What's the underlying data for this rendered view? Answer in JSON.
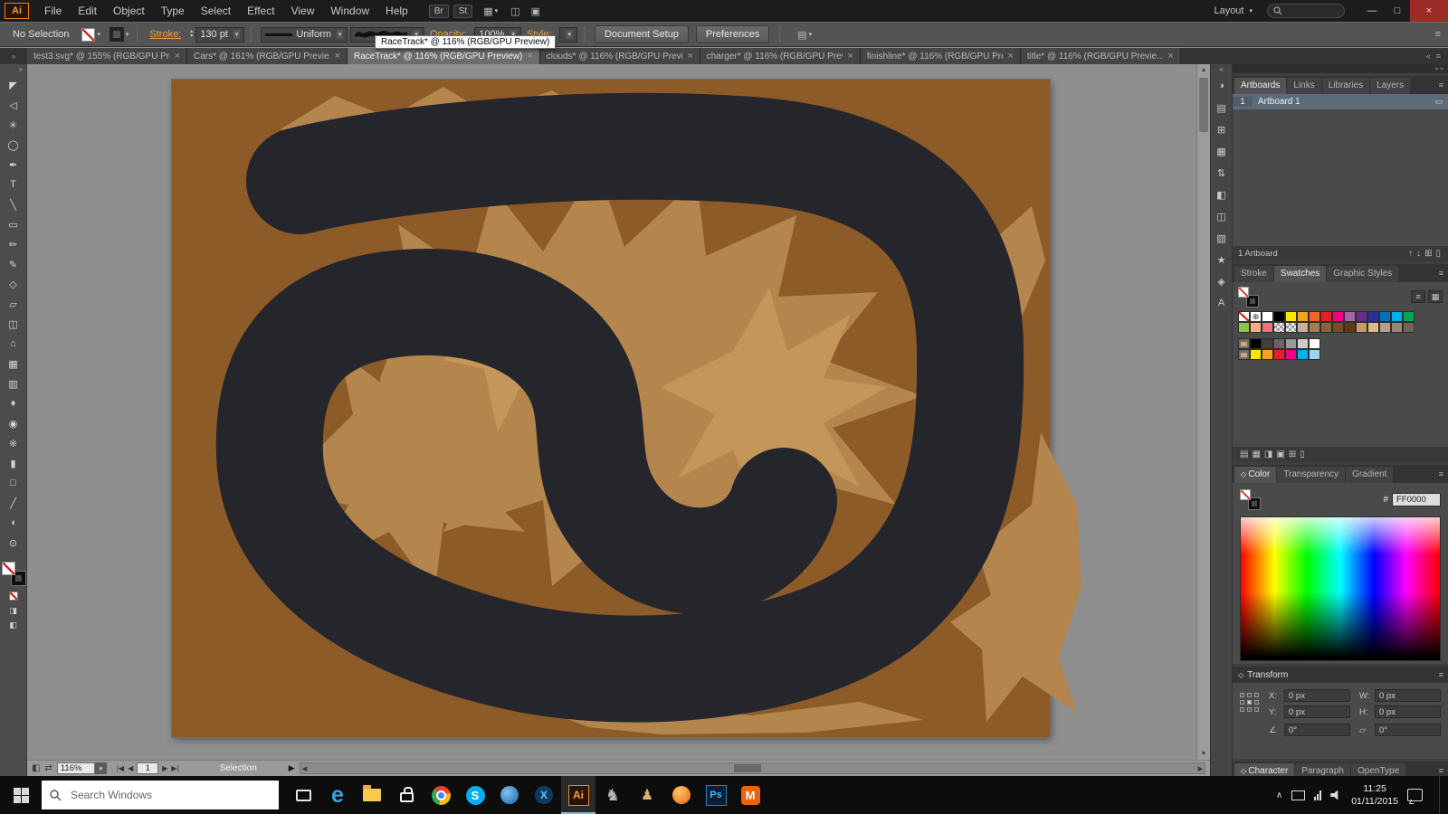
{
  "menubar": {
    "logo": "Ai",
    "menus": [
      "File",
      "Edit",
      "Object",
      "Type",
      "Select",
      "Effect",
      "View",
      "Window",
      "Help"
    ],
    "quick_buttons": [
      "Br",
      "St"
    ],
    "layout_label": "Layout",
    "win_controls": [
      "—",
      "□",
      "×"
    ]
  },
  "controlbar": {
    "selection_label": "No Selection",
    "stroke_label": "Stroke:",
    "stroke_width": "130 pt",
    "profile_label": "Uniform",
    "opacity_label": "Opacity:",
    "opacity_value": "100%",
    "style_label": "Style:",
    "document_setup": "Document Setup",
    "preferences": "Preferences",
    "tooltip": "RaceTrack* @ 116% (RGB/GPU Preview)"
  },
  "tabs": [
    {
      "label": "test3.svg* @ 155% (RGB/GPU Prev...",
      "active": false
    },
    {
      "label": "Cars* @ 161% (RGB/GPU Previe...",
      "active": false
    },
    {
      "label": "RaceTrack* @ 116% (RGB/GPU Preview)",
      "active": true
    },
    {
      "label": "clouds* @ 116% (RGB/GPU Previe...",
      "active": false
    },
    {
      "label": "charger* @ 116% (RGB/GPU Previ...",
      "active": false
    },
    {
      "label": "finishline* @ 116% (RGB/GPU Pre...",
      "active": false
    },
    {
      "label": "title* @ 116% (RGB/GPU Previe...",
      "active": false
    }
  ],
  "toolbox": {
    "tools": [
      {
        "name": "selection-tool",
        "glyph": "◤"
      },
      {
        "name": "direct-selection-tool",
        "glyph": "◁"
      },
      {
        "name": "magic-wand-tool",
        "glyph": "✳"
      },
      {
        "name": "lasso-tool",
        "glyph": "◯"
      },
      {
        "name": "pen-tool",
        "glyph": "✒"
      },
      {
        "name": "type-tool",
        "glyph": "T"
      },
      {
        "name": "line-segment-tool",
        "glyph": "╲"
      },
      {
        "name": "rectangle-tool",
        "glyph": "▭"
      },
      {
        "name": "paintbrush-tool",
        "glyph": "✏"
      },
      {
        "name": "pencil-tool",
        "glyph": "✎"
      },
      {
        "name": "width-tool",
        "glyph": "◇"
      },
      {
        "name": "free-transform-tool",
        "glyph": "▱"
      },
      {
        "name": "shape-builder-tool",
        "glyph": "◫"
      },
      {
        "name": "perspective-grid-tool",
        "glyph": "⌂"
      },
      {
        "name": "mesh-tool",
        "glyph": "▦"
      },
      {
        "name": "gradient-tool",
        "glyph": "▥"
      },
      {
        "name": "eyedropper-tool",
        "glyph": "♦"
      },
      {
        "name": "blend-tool",
        "glyph": "◉"
      },
      {
        "name": "symbol-sprayer-tool",
        "glyph": "※"
      },
      {
        "name": "column-graph-tool",
        "glyph": "▮"
      },
      {
        "name": "artboard-tool",
        "glyph": "□"
      },
      {
        "name": "slice-tool",
        "glyph": "╱"
      },
      {
        "name": "hand-tool",
        "glyph": "◖"
      },
      {
        "name": "zoom-tool",
        "glyph": "⊙"
      }
    ]
  },
  "canvas": {
    "artboard_color": "#8d5b28",
    "splat_color": "#b5854e",
    "splat_bright_color": "#c49659",
    "track_color": "#24262b",
    "background": "#8f8f8f"
  },
  "dock_strip": {
    "icons": [
      {
        "name": "color-strip-icon",
        "glyph": "◑"
      },
      {
        "name": "swatches-strip-icon",
        "glyph": "▤"
      },
      {
        "name": "symbols-strip-icon",
        "glyph": "⊞"
      },
      {
        "name": "transparency-strip-icon",
        "glyph": "▦"
      },
      {
        "name": "align-strip-icon",
        "glyph": "⇅"
      },
      {
        "name": "appearance-strip-icon",
        "glyph": "◧"
      },
      {
        "name": "graphic-styles-strip-icon",
        "glyph": "◫"
      },
      {
        "name": "pathfinder-strip-icon",
        "glyph": "▧"
      },
      {
        "name": "brushes-strip-icon",
        "glyph": "★"
      },
      {
        "name": "links-strip-icon",
        "glyph": "◈"
      },
      {
        "name": "character-styles-strip-icon",
        "glyph": "A"
      }
    ]
  },
  "panels": {
    "artboards": {
      "tabs": {
        "items": [
          "Artboards",
          "Links",
          "Libraries",
          "Layers"
        ],
        "active": 0
      },
      "row_num": "1",
      "row_name": "Artboard 1",
      "footer": "1 Artboard",
      "footer_icons": [
        "↑",
        "↓",
        "⊞",
        "▯"
      ]
    },
    "swatches": {
      "tabs": {
        "items": [
          "Stroke",
          "Swatches",
          "Graphic Styles"
        ],
        "active": 1
      },
      "rows": [
        [
          "none",
          "reg",
          "#ffffff",
          "#000000",
          "#fde500",
          "#f8a11b",
          "#f26522",
          "#ed1c24",
          "#ec008c",
          "#a864a8",
          "#662d91",
          "#2e3192",
          "#0072bc",
          "#00aeef",
          "#00a651"
        ],
        [
          "#8dc63f",
          "#f9ad81",
          "#f26d7d",
          "pattern",
          "pattern",
          "#c7b299",
          "#a67c52",
          "#8c6239",
          "#754c24",
          "#603913",
          "#c69c6d",
          "#deb887",
          "#b8a088",
          "#998675",
          "#736357"
        ],
        [
          "folder",
          "#000000",
          "#404040",
          "#666666",
          "#999999",
          "#cccccc",
          "#ffffff"
        ],
        [
          "folder",
          "#fde500",
          "#f8a11b",
          "#ed1c24",
          "#ec008c",
          "#00aeef",
          "#9ad6f0"
        ]
      ],
      "footer_icons": [
        "▤",
        "▦",
        "◨",
        "▣",
        "⊞",
        "▯"
      ]
    },
    "color": {
      "tabs": {
        "items": [
          "Color",
          "Transparency",
          "Gradient"
        ],
        "active": 0
      },
      "hex_label": "#",
      "hex_value": "FF0000"
    },
    "transform": {
      "title": "Transform",
      "x_label": "X:",
      "x_value": "0 px",
      "y_label": "Y:",
      "y_value": "0 px",
      "w_label": "W:",
      "w_value": "0 px",
      "h_label": "H:",
      "h_value": "0 px",
      "rotate_value": "0°",
      "shear_value": "0°"
    },
    "type_tabs": {
      "items": [
        "Character",
        "Paragraph",
        "OpenType"
      ],
      "active": 0
    }
  },
  "statusbar": {
    "zoom": "116%",
    "artboard_value": "1",
    "status_text": "Selection"
  },
  "taskbar": {
    "search_placeholder": "Search Windows",
    "time": "11:25",
    "date": "01/11/2015",
    "apps": [
      {
        "name": "task-view-button",
        "kind": "taskview"
      },
      {
        "name": "edge-app",
        "kind": "edge",
        "glyph": "e"
      },
      {
        "name": "file-explorer-app",
        "kind": "folder"
      },
      {
        "name": "store-app",
        "kind": "bag"
      },
      {
        "name": "chrome-app",
        "kind": "chrome"
      },
      {
        "name": "skype-app",
        "kind": "skype",
        "glyph": "S"
      },
      {
        "name": "blue-disc-app",
        "kind": "disc"
      },
      {
        "name": "x-app",
        "kind": "xapp",
        "glyph": "X"
      },
      {
        "name": "illustrator-app",
        "kind": "ai",
        "glyph": "Ai",
        "active": true
      },
      {
        "name": "dark-app",
        "kind": "darkapp",
        "glyph": "♞"
      },
      {
        "name": "tool-app",
        "kind": "toolapp",
        "glyph": "♟"
      },
      {
        "name": "orange-app",
        "kind": "orangeapp"
      },
      {
        "name": "photoshop-app",
        "kind": "ps",
        "glyph": "Ps"
      },
      {
        "name": "m-app",
        "kind": "mapp",
        "glyph": "M"
      }
    ]
  }
}
